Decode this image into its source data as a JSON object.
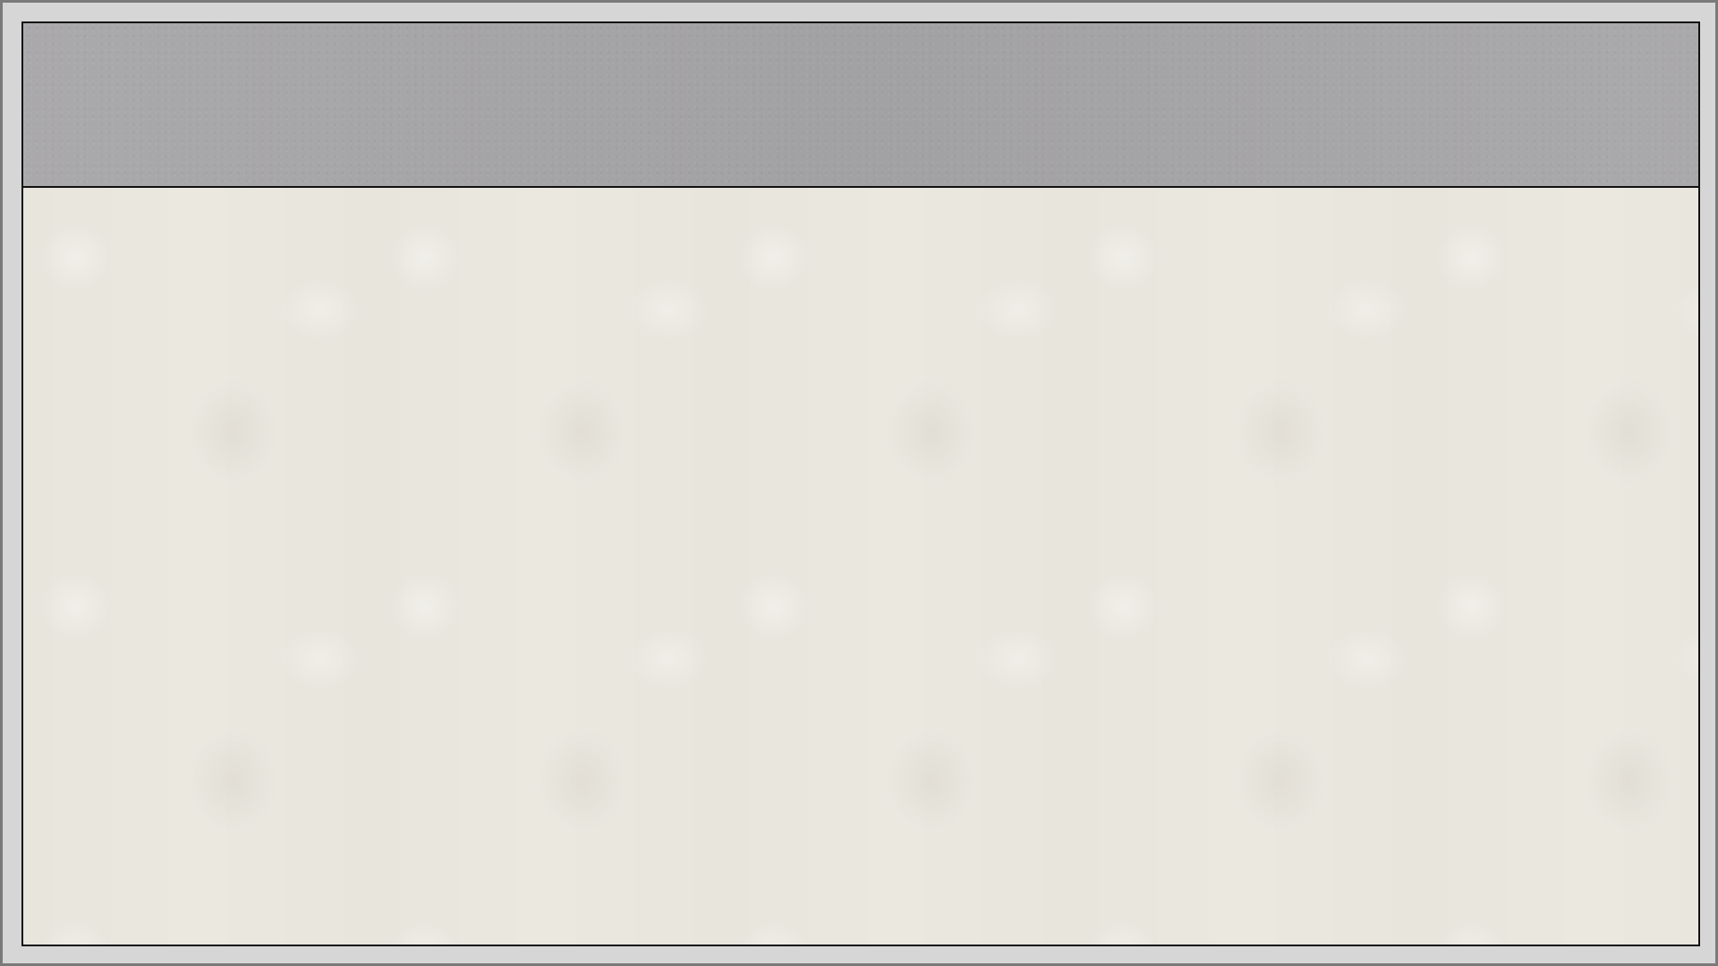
{
  "colors": {
    "outer_background": "#d6d6d6",
    "header_band": "#a7a6a8",
    "content_background": "#ebe8e0",
    "border": "#111111"
  },
  "header": {
    "title": ""
  },
  "content": {
    "text": ""
  }
}
